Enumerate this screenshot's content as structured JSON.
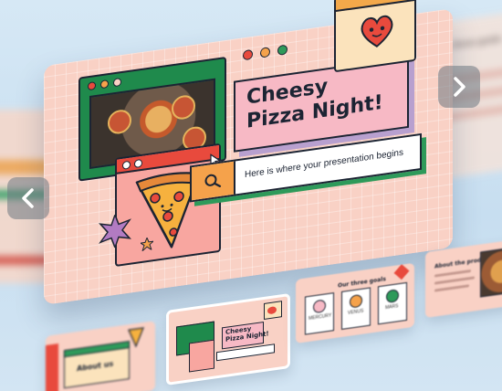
{
  "main_slide": {
    "title_line1": "Cheesy",
    "title_line2": "Pizza Night!",
    "search_text": "Here is where your presentation begins"
  },
  "thumbnails": [
    {
      "title": "About us"
    },
    {
      "title_line1": "Cheesy",
      "title_line2": "Pizza Night!"
    },
    {
      "title": "Our three goals",
      "items": [
        "MERCURY",
        "VENUS",
        "MARS"
      ]
    },
    {
      "title": "About the product"
    }
  ],
  "background_slide": {
    "title": "Our three goals"
  },
  "colors": {
    "slide_bg": "#f9d1c5",
    "green": "#1f8a4c",
    "red": "#e84a3d",
    "orange": "#f5a24b",
    "pink": "#f7b9c5",
    "purple": "#b8a0cf",
    "ink": "#1c2433"
  },
  "icons": [
    "chevron-left-icon",
    "chevron-right-icon",
    "search-icon",
    "heart-icon",
    "pizza-slice-icon",
    "cursor-icon",
    "starburst-icon"
  ]
}
